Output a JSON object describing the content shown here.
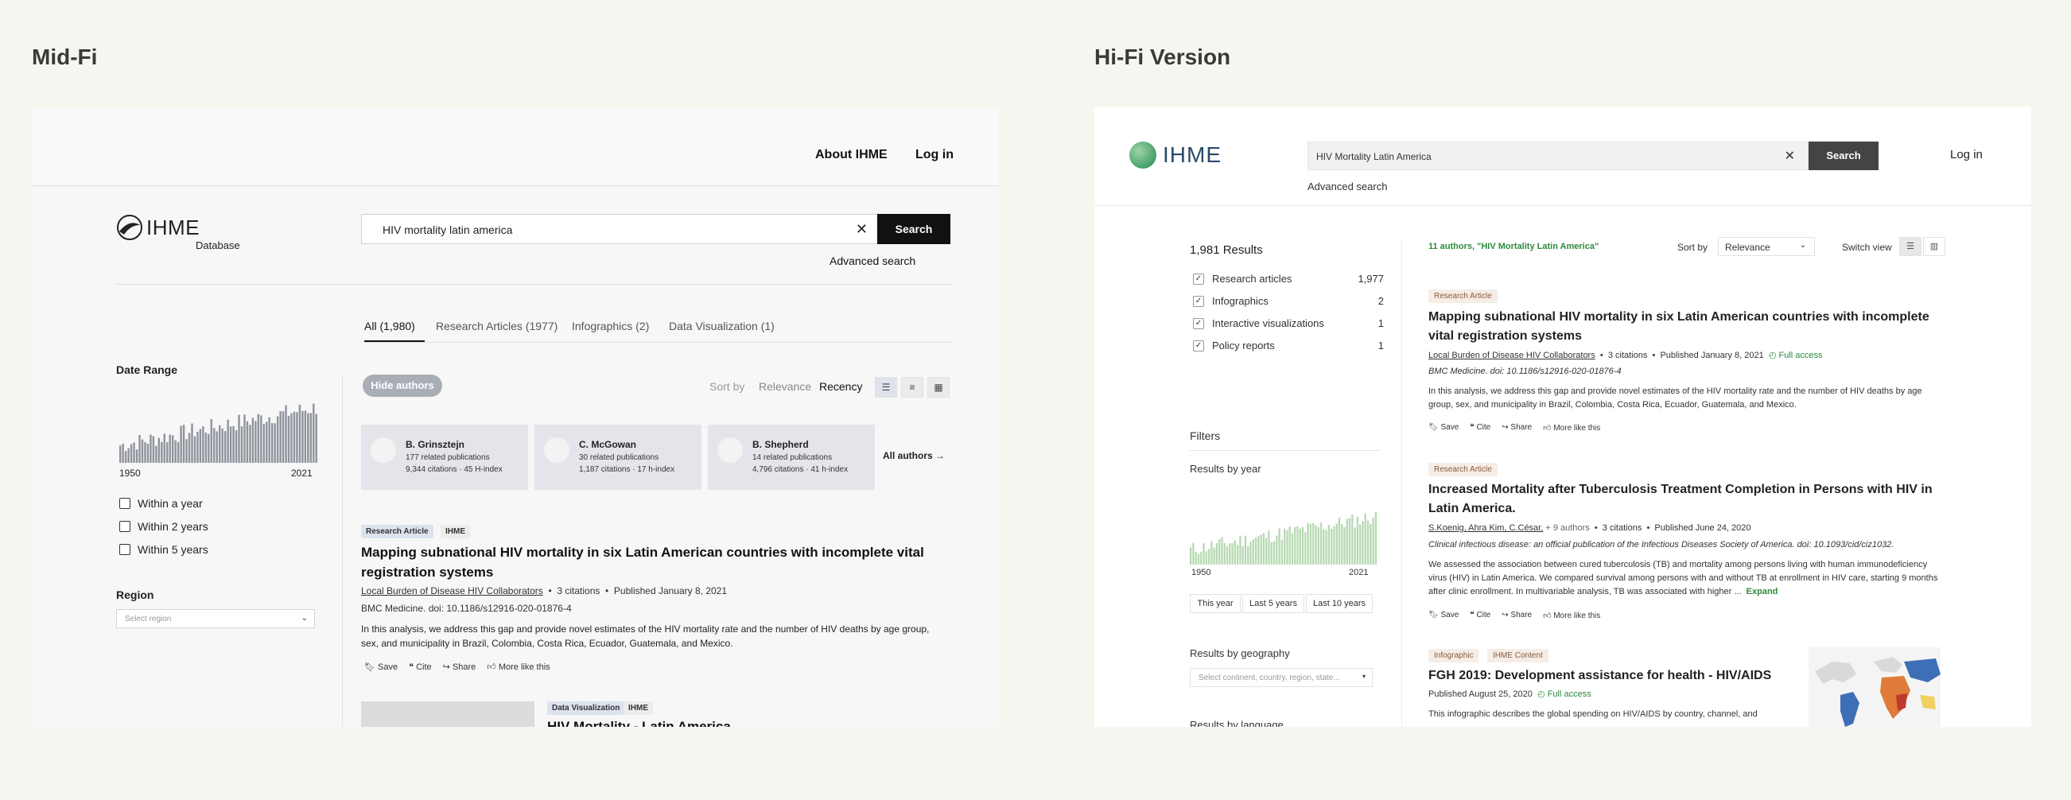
{
  "sections": {
    "midfi_title": "Mid-Fi",
    "hifi_title": "Hi-Fi Version"
  },
  "midfi": {
    "nav": {
      "about": "About IHME",
      "login": "Log in"
    },
    "logo": {
      "wordmark": "IHME",
      "sub": "Database"
    },
    "search": {
      "value": "HIV mortality latin america",
      "button": "Search",
      "advanced": "Advanced search",
      "clear": "✕"
    },
    "tabs": [
      {
        "label": "All  (1,980)"
      },
      {
        "label": "Research Articles (1977)"
      },
      {
        "label": "Infographics (2)"
      },
      {
        "label": "Data Visualization (1)"
      }
    ],
    "date_range": {
      "label": "Date Range",
      "start": "1950",
      "end": "2021"
    },
    "date_options": [
      "Within a year",
      "Within 2 years",
      "Within 5 years"
    ],
    "region": {
      "label": "Region",
      "placeholder": "Select region"
    },
    "hide_authors": "Hide authors",
    "sort": {
      "label": "Sort by",
      "relevance": "Relevance",
      "recency": "Recency"
    },
    "authors": [
      {
        "name": "B. Grinsztejn",
        "related": "177 related publications",
        "citations": "9,344 citations · 45 H-index"
      },
      {
        "name": "C. McGowan",
        "related": "30 related publications",
        "citations": "1,187 citations · 17 h-index"
      },
      {
        "name": "B. Shepherd",
        "related": "14 related publications",
        "citations": "4,796 citations · 41 h-index"
      }
    ],
    "all_authors": "All authors  →",
    "result1": {
      "tags": [
        "Research Article",
        "IHME"
      ],
      "title": "Mapping subnational HIV mortality in six Latin American countries with incomplete vital registration systems",
      "author": "Local Burden of Disease HIV Collaborators",
      "citations": "3 citations",
      "published": "Published January 8, 2021",
      "journal": "BMC Medicine. doi: 10.1186/s12916-020-01876-4",
      "abstract": "In this analysis, we address this gap and provide novel estimates of the HIV mortality rate and the number of HIV deaths by age group, sex, and municipality in Brazil, Colombia, Costa Rica, Ecuador, Guatemala, and Mexico.",
      "actions": [
        "Save",
        "Cite",
        "Share",
        "More like this"
      ]
    },
    "result2": {
      "tags": [
        "Data Visualization",
        "IHME"
      ],
      "title": "HIV Mortality - Latin America"
    }
  },
  "hifi": {
    "logo": {
      "wordmark": "IHME"
    },
    "search": {
      "value": "HIV Mortality Latin America",
      "button": "Search",
      "advanced": "Advanced search",
      "clear": "✕"
    },
    "login": "Log in",
    "results_count": "1,981 Results",
    "types": [
      {
        "label": "Research articles",
        "count": "1,977"
      },
      {
        "label": "Infographics",
        "count": "2"
      },
      {
        "label": "Interactive visualizations",
        "count": "1"
      },
      {
        "label": "Policy reports",
        "count": "1"
      }
    ],
    "filters": "Filters",
    "year": {
      "label": "Results by year",
      "start": "1950",
      "end": "2021",
      "buttons": [
        "This year",
        "Last 5 years",
        "Last 10 years"
      ]
    },
    "geo": {
      "label": "Results by geography",
      "placeholder": "Select continent, country, region, state..."
    },
    "language_label": "Results by language",
    "authors_match": "11 authors, \"HIV Mortality Latin America\"",
    "sort": {
      "label": "Sort by",
      "value": "Relevance"
    },
    "switch_view": "Switch view",
    "result1": {
      "tag": "Research Article",
      "title": "Mapping subnational HIV mortality in six Latin American countries with incomplete vital registration systems",
      "author": "Local Burden of Disease HIV Collaborators",
      "citations": "3 citations",
      "published": "Published January 8, 2021",
      "access": "Full access",
      "journal": "BMC Medicine. doi: 10.1186/s12916-020-01876-4",
      "abstract": "In this analysis, we address this gap and provide novel estimates of the HIV mortality rate and the number of HIV deaths by age group, sex, and municipality in Brazil, Colombia, Costa Rica, Ecuador, Guatemala, and Mexico."
    },
    "result2": {
      "tag": "Research Article",
      "title": "Increased Mortality after Tuberculosis Treatment Completion in Persons with HIV in Latin America.",
      "authors": "S.Koenig, Ahra Kim, C.César,",
      "more_authors": "+ 9 authors",
      "citations": "3 citations",
      "published": "Published June 24, 2020",
      "journal": "Clinical infectious disease: an official publication of the Infectious Diseases Society of America. doi: 10.1093/cid/ciz1032.",
      "abstract": "We assessed the association between cured tuberculosis (TB) and mortality among persons living with human immunodeficiency virus (HIV) in Latin America. We compared survival among persons with and without TB at enrollment in HIV care, starting 9 months after clinic enrollment. In multivariable analysis, TB was associated with higher ...",
      "expand": "Expand"
    },
    "result3": {
      "tags": [
        "Infographic",
        "IHME Content"
      ],
      "title": "FGH 2019: Development assistance for health - HIV/AIDS",
      "published": "Published August 25, 2020",
      "access": "Full access",
      "abstract": "This infographic describes the global spending on HIV/AIDS by country, channel, and"
    },
    "actions": [
      "Save",
      "Cite",
      "Share",
      "More like this"
    ]
  }
}
